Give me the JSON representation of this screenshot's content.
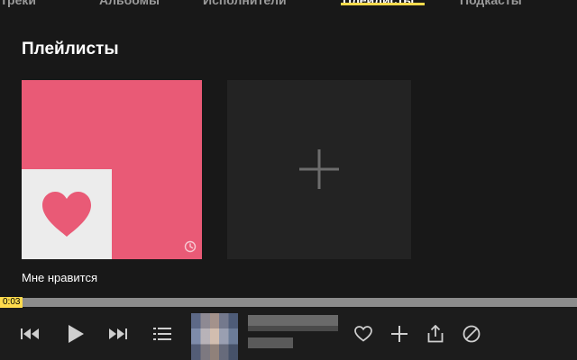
{
  "tabs": [
    {
      "label": "Треки"
    },
    {
      "label": "Альбомы"
    },
    {
      "label": "Исполнители"
    },
    {
      "label": "Плейлисты",
      "active": true
    },
    {
      "label": "Подкасты"
    }
  ],
  "section": {
    "title": "Плейлисты"
  },
  "playlists": [
    {
      "title": "Мне нравится",
      "icon": "heart-icon",
      "color": "#e95a76"
    }
  ],
  "new_playlist": {
    "icon": "plus-icon"
  },
  "player": {
    "current_time": "0:03",
    "progress": 0.01,
    "accent": "#ffdb4d",
    "controls": [
      "prev-icon",
      "play-icon",
      "next-icon",
      "queue-icon",
      "like-icon",
      "add-icon",
      "share-icon",
      "block-icon"
    ]
  }
}
